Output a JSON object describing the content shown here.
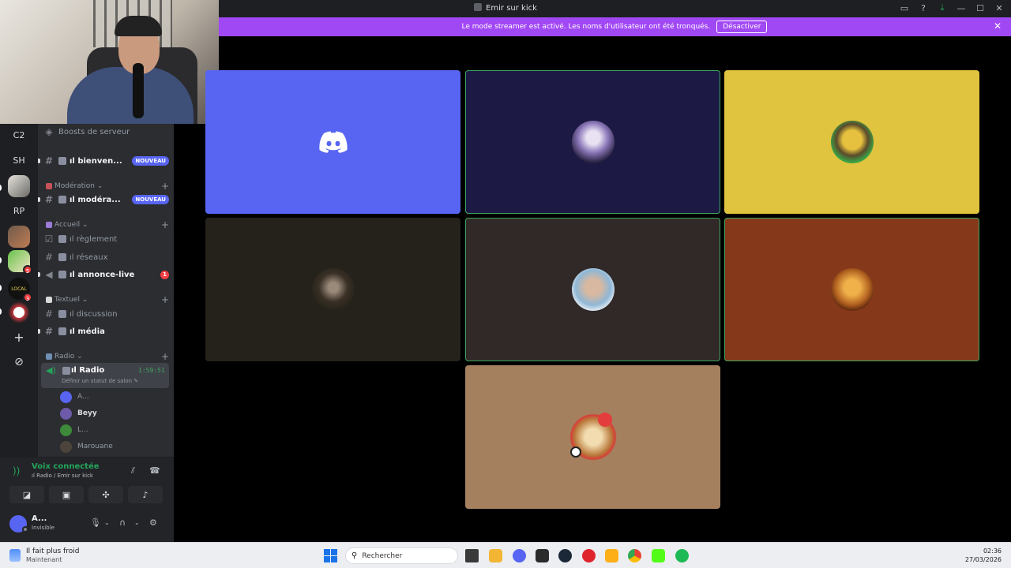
{
  "window": {
    "title": "Emir sur kick"
  },
  "banner": {
    "text": "Le mode streamer est activé. Les noms d'utilisateur ont été tronqués.",
    "button": "Désactiver"
  },
  "servers": [
    {
      "label": "C2"
    },
    {
      "label": "SH"
    },
    {
      "label": ""
    },
    {
      "label": "RP"
    },
    {
      "label": ""
    },
    {
      "label": "",
      "badge": "5"
    },
    {
      "label": "",
      "badge": "3"
    },
    {
      "label": ""
    },
    {
      "label": "+"
    },
    {
      "label": "⊘"
    }
  ],
  "sidebar": {
    "boosts": "Boosts de serveur",
    "channels": {
      "bienvenue": {
        "label": "ıl bienven...",
        "tag": "NOUVEAU"
      },
      "moderation_cat": "Modération",
      "moderateurs": {
        "label": "ıl modéra...",
        "tag": "NOUVEAU"
      },
      "accueil_cat": "Accueil",
      "reglement": "ıl règlement",
      "reseaux": "ıl réseaux",
      "annonce": {
        "label": "ıl annonce-live",
        "count": "1"
      },
      "textuel_cat": "Textuel",
      "discussion": "ıl discussion",
      "media": "ıl média",
      "radio_cat": "Radio",
      "radio": {
        "label": "ıl Radio",
        "time": "1:59:51",
        "status": "Définir un statut de salon"
      }
    },
    "voice_users": [
      "A...",
      "Beyy",
      "L...",
      "Marouane"
    ]
  },
  "voice_panel": {
    "title": "Voix connectée",
    "subtitle": "ıl Radio / Emir sur kick"
  },
  "user": {
    "name": "A...",
    "status": "Invisible"
  },
  "taskbar": {
    "weather_title": "Il fait plus froid",
    "weather_sub": "Maintenant",
    "search_placeholder": "Rechercher",
    "time": "02:36",
    "date": "27/03/2026"
  },
  "colors": {
    "accent": "#5865f2",
    "banner": "#a148f5",
    "speaking": "#3ba55d",
    "tile_1": "#5865f2",
    "tile_2": "#1c1a44",
    "tile_3": "#e0c33e",
    "tile_4": "#24221a",
    "tile_5": "#312828",
    "tile_6": "#86391a",
    "tile_7": "#a5805e"
  },
  "icons": [
    "discord-logo-icon",
    "mic-icon",
    "headphones-icon",
    "settings-icon",
    "hangup-icon",
    "camera-off-icon",
    "screen-share-icon",
    "activity-icon",
    "soundboard-icon"
  ]
}
